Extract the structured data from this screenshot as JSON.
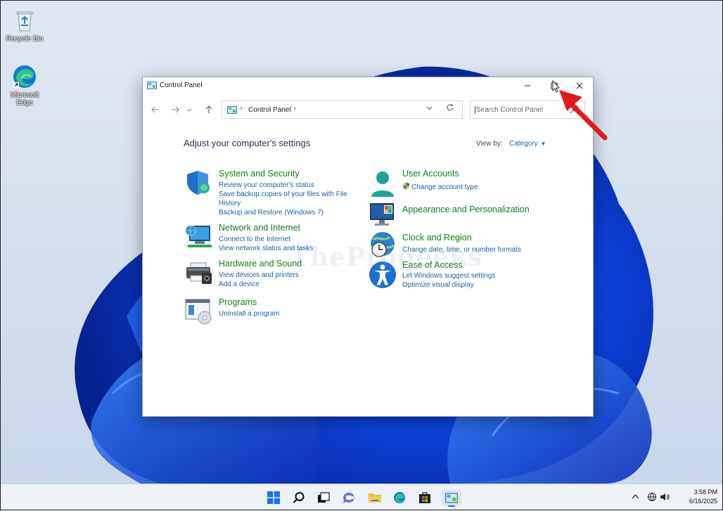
{
  "desktop": {
    "icons": [
      {
        "label": "Recycle Bin"
      },
      {
        "label": "Microsoft Edge"
      }
    ]
  },
  "window": {
    "title": "Control Panel",
    "address": {
      "crumb": "Control Panel",
      "separator": "›"
    },
    "search": {
      "placeholder": "Search Control Panel"
    },
    "heading": "Adjust your computer's settings",
    "view_by": {
      "label": "View by:",
      "value": "Category"
    },
    "categories": [
      {
        "title": "System and Security",
        "links": [
          "Review your computer's status",
          "Save backup copies of your files with File History",
          "Backup and Restore (Windows 7)"
        ]
      },
      {
        "title": "Network and Internet",
        "links": [
          "Connect to the Internet",
          "View network status and tasks"
        ]
      },
      {
        "title": "Hardware and Sound",
        "links": [
          "View devices and printers",
          "Add a device"
        ]
      },
      {
        "title": "Programs",
        "links": [
          "Uninstall a program"
        ]
      },
      {
        "title": "User Accounts",
        "links": [
          "Change account type"
        ]
      },
      {
        "title": "Appearance and Personalization",
        "links": []
      },
      {
        "title": "Clock and Region",
        "links": [
          "Change date, time, or number formats"
        ]
      },
      {
        "title": "Ease of Access",
        "links": [
          "Let Windows suggest settings",
          "Optimize visual display"
        ]
      }
    ]
  },
  "watermark": "TheProgeeks",
  "taskbar": {
    "clock": {
      "time": "3:58 PM",
      "date": "6/16/2025"
    }
  },
  "colors": {
    "accent": "#1565c0",
    "category_title": "#1a7a1a",
    "link": "#1b5fa8",
    "arrow": "#e01b1b"
  }
}
